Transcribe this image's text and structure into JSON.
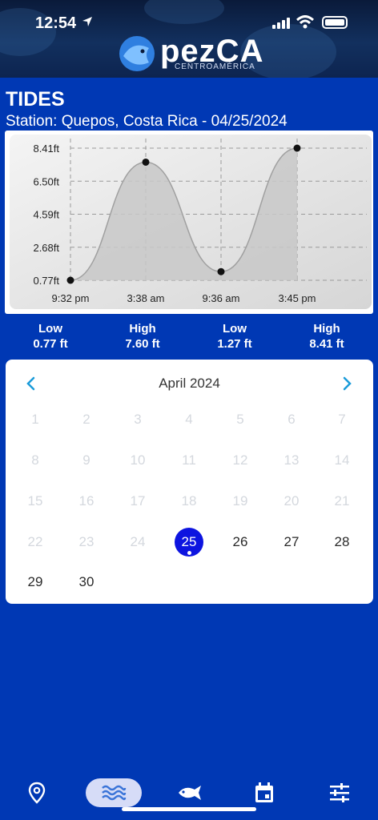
{
  "status_bar": {
    "time": "12:54"
  },
  "brand": {
    "name": "pezCA",
    "subtitle": "CENTROAMÉRICA"
  },
  "page": {
    "title": "TIDES",
    "station": "Station: Quepos, Costa Rica - 04/25/2024"
  },
  "chart_data": {
    "type": "area",
    "x": [
      "9:32 pm",
      "3:38 am",
      "9:36 am",
      "3:45 pm"
    ],
    "series": [
      {
        "values": [
          0.77,
          7.6,
          1.27,
          8.41
        ]
      }
    ],
    "y_ticks": [
      "8.41ft",
      "6.50ft",
      "4.59ft",
      "2.68ft",
      "0.77ft"
    ],
    "ylim": [
      0.77,
      8.41
    ],
    "grid": true,
    "colors": {
      "fill": "#c8c8c8",
      "line": "#a0a0a0",
      "point": "#111111"
    }
  },
  "tides": [
    {
      "type": "Low",
      "height": "0.77 ft"
    },
    {
      "type": "High",
      "height": "7.60 ft"
    },
    {
      "type": "Low",
      "height": "1.27 ft"
    },
    {
      "type": "High",
      "height": "8.41 ft"
    }
  ],
  "calendar": {
    "month": "April 2024",
    "prev_icon": "chevron-left-icon",
    "next_icon": "chevron-right-icon",
    "weeks": [
      [
        "1",
        "2",
        "3",
        "4",
        "5",
        "6",
        "7"
      ],
      [
        "8",
        "9",
        "10",
        "11",
        "12",
        "13",
        "14"
      ],
      [
        "15",
        "16",
        "17",
        "18",
        "19",
        "20",
        "21"
      ],
      [
        "22",
        "23",
        "24",
        "25",
        "26",
        "27",
        "28"
      ],
      [
        "29",
        "30"
      ]
    ],
    "selected": "25",
    "first_active": 25,
    "colors": {
      "selected": "#0d14e0",
      "disabled": "#d4d8de"
    }
  },
  "tabbar": {
    "items": [
      "location-pin-icon",
      "waves-icon",
      "fish-icon",
      "calendar-icon",
      "sliders-icon"
    ],
    "active": "waves-icon"
  },
  "colors": {
    "background": "#0038b4",
    "accent": "#1a9bd9"
  }
}
